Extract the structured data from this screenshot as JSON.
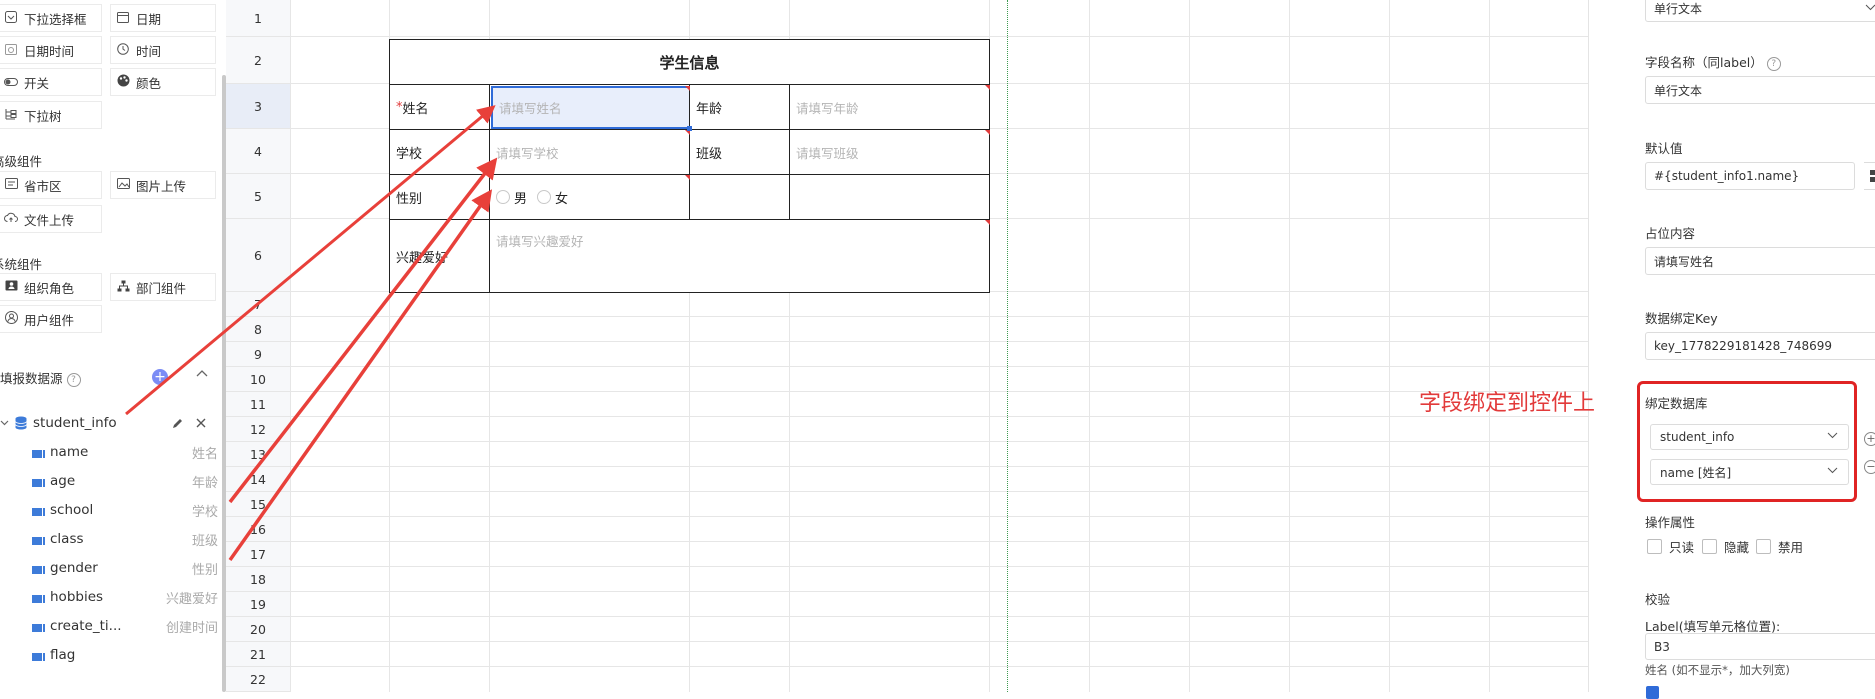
{
  "left_panel": {
    "basic_components": [
      {
        "label": "下拉选择框",
        "icon": "dropdown-icon"
      },
      {
        "label": "日期",
        "icon": "calendar-icon"
      },
      {
        "label": "日期时间",
        "icon": "datetime-icon"
      },
      {
        "label": "时间",
        "icon": "clock-icon"
      },
      {
        "label": "开关",
        "icon": "toggle-icon"
      },
      {
        "label": "颜色",
        "icon": "palette-icon"
      },
      {
        "label": "下拉树",
        "icon": "tree-icon"
      }
    ],
    "advanced_title": "高级组件",
    "advanced_components": [
      {
        "label": "省市区",
        "icon": "region-icon"
      },
      {
        "label": "图片上传",
        "icon": "image-icon"
      },
      {
        "label": "文件上传",
        "icon": "cloud-upload-icon"
      }
    ],
    "system_title": "系统组件",
    "system_components": [
      {
        "label": "组织角色",
        "icon": "org-icon"
      },
      {
        "label": "部门组件",
        "icon": "department-icon"
      },
      {
        "label": "用户组件",
        "icon": "user-icon"
      }
    ],
    "datasource_title": "填报数据源",
    "datasource": {
      "name": "student_info",
      "fields": [
        {
          "key": "name",
          "label": "姓名"
        },
        {
          "key": "age",
          "label": "年龄"
        },
        {
          "key": "school",
          "label": "学校"
        },
        {
          "key": "class",
          "label": "班级"
        },
        {
          "key": "gender",
          "label": "性别"
        },
        {
          "key": "hobbies",
          "label": "兴趣爱好"
        },
        {
          "key": "create_ti...",
          "label": "创建时间"
        },
        {
          "key": "flag",
          "label": ""
        }
      ]
    }
  },
  "sheet": {
    "row_numbers": [
      "1",
      "2",
      "3",
      "4",
      "5",
      "6",
      "7",
      "8",
      "9",
      "10",
      "11",
      "12",
      "13",
      "14",
      "15",
      "16",
      "17",
      "18",
      "19",
      "20",
      "21",
      "22"
    ],
    "active_row": "3",
    "form": {
      "title": "学生信息",
      "required_mark": "*",
      "name_label": "姓名",
      "name_placeholder": "请填写姓名",
      "age_label": "年龄",
      "age_placeholder": "请填写年龄",
      "school_label": "学校",
      "school_placeholder": "请填写学校",
      "class_label": "班级",
      "class_placeholder": "请填写班级",
      "gender_label": "性别",
      "gender_male": "男",
      "gender_female": "女",
      "hobbies_label": "兴趣爱好",
      "hobbies_placeholder": "请填写兴趣爱好"
    },
    "accent_color": "#2f6bd8"
  },
  "annotation": {
    "text": "字段绑定到控件上",
    "color": "#e23a3a"
  },
  "right_panel": {
    "type_value": "单行文本",
    "field_name_label": "字段名称（同label）",
    "field_name_value": "单行文本",
    "default_label": "默认值",
    "default_value": "#{student_info1.name}",
    "placeholder_label": "占位内容",
    "placeholder_value": "请填写姓名",
    "bind_key_label": "数据绑定Key",
    "bind_key_value": "key_1778229181428_748699",
    "bind_db_label": "绑定数据库",
    "bind_db_value": "student_info",
    "bind_field_value": "name [姓名]",
    "op_label": "操作属性",
    "op_readonly": "只读",
    "op_hidden": "隐藏",
    "op_disabled": "禁用",
    "validate_label": "校验",
    "cell_pos_label": "Label(填写单元格位置):",
    "cell_pos_value": "B3",
    "cell_pos_hint": "姓名 (如不显示*，加大列宽)"
  }
}
